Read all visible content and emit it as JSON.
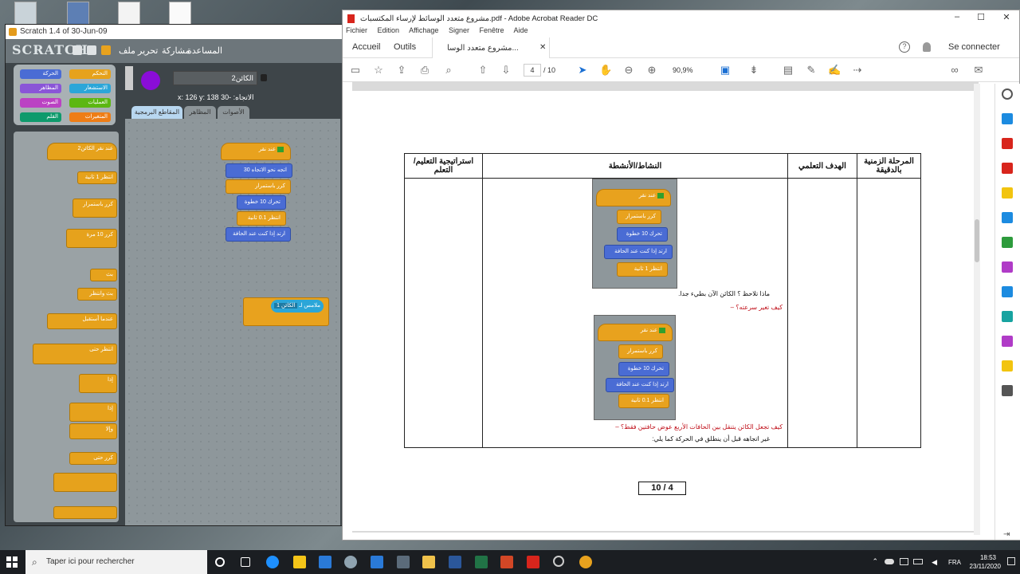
{
  "desktop": {
    "icons": [
      {
        "name": "recycle-bin-icon"
      },
      {
        "name": "folder-icon"
      },
      {
        "name": "file-icon"
      },
      {
        "name": "document-icon"
      }
    ]
  },
  "scratch": {
    "title": "Scratch 1.4 of 30-Jun-09",
    "logo": "SCRATCH",
    "menus": [
      "المساعدة",
      "مشاركة",
      "تحرير",
      "ملف"
    ],
    "categories": [
      "التحكم",
      "الحركة",
      "الاستشعار",
      "المظاهر",
      "العمليات",
      "الصوت",
      "المتغيرات",
      "القلم"
    ],
    "sprite_name": "الكائن2",
    "coords": {
      "x": "x: 126",
      "y": "y: 138",
      "dir_label": "الاتجاه:",
      "dir": "-30"
    },
    "tabs": [
      "المقاطع البرمجية",
      "المظاهر",
      "الأصوات"
    ],
    "palette": [
      "عند نقر الكائن2",
      "انتظر 1 ثانية",
      "كرر باستمرار",
      "كرر 10 مرة",
      "بث",
      "بث وانتظر",
      "عندما أستقبل",
      "انتظر حتى",
      "إذا",
      "إذا",
      "وإلا",
      "كرر حتى"
    ],
    "script": [
      "عند نقر",
      "اتجه نحو الاتجاه 30",
      "كرر باستمرار",
      "تحرك 10 خطوة",
      "انتظر 0.1 ثانية",
      "ارتد إذا كنت عند الحافة"
    ],
    "script2": [
      "الكائن 1",
      "ملامس لـ"
    ]
  },
  "acrobat": {
    "title": "مشروع متعدد الوسائط لإرساء المكتسبات.pdf - Adobe Acrobat Reader DC",
    "menus": [
      "Fichier",
      "Edition",
      "Affichage",
      "Signer",
      "Fenêtre",
      "Aide"
    ],
    "tabs": {
      "home": "Accueil",
      "tools": "Outils",
      "doc": "مشروع متعدد الوسا..."
    },
    "sign_in": "Se connecter",
    "page_current": "4",
    "page_total": "/ 10",
    "zoom": "90,9%",
    "table": {
      "headers": [
        "المرحلة الزمنية بالدقيقة",
        "الهدف التعلمي",
        "النشاط/الأنشطة",
        "استراتيجية التعليم/التعلم"
      ],
      "block1": [
        "عند نقر",
        "كرر باستمرار",
        "تحرك 10 خطوة",
        "ارتد إذا كنت عند الحافة",
        "انتظر 1 ثانية"
      ],
      "line1": "ماذا تلاحظ ؟ الكائن الآن بطيء جدا.",
      "q1": "كيف تغير سرعته؟",
      "block2": [
        "عند نقر",
        "كرر باستمرار",
        "تحرك 10 خطوة",
        "ارتد إذا كنت عند الحافة",
        "انتظر 0.1 ثانية"
      ],
      "q2": "كيف تجعل الكائن يتنقل بين الحافات الأربع عوض حافتين فقط؟",
      "line2": "غير اتجاهه قبل أن ينطلق في الحركة كما يلي:"
    },
    "page_footer": "10 / 4",
    "colors": {
      "question": "#c0101a",
      "scratch_control": "#e6a21c",
      "scratch_motion": "#4a6cd4"
    }
  },
  "taskbar": {
    "search_placeholder": "Taper ici pour rechercher",
    "lang": "FRA",
    "time": "18:53",
    "date": "23/11/2020"
  }
}
